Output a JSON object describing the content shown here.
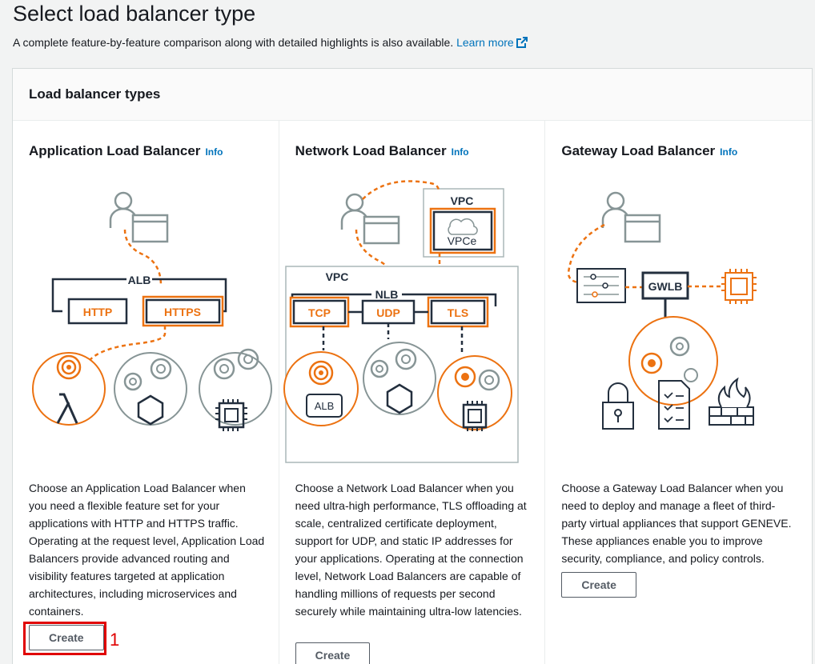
{
  "header": {
    "title": "Select load balancer type",
    "subtitle": "A complete feature-by-feature comparison along with detailed highlights is also available.",
    "learn_more": "Learn more",
    "learn_more_icon": "external-link-icon"
  },
  "panel": {
    "title": "Load balancer types"
  },
  "cards": [
    {
      "title": "Application Load Balancer",
      "info": "Info",
      "diagram": {
        "alb": "ALB",
        "http": "HTTP",
        "https": "HTTPS"
      },
      "description": "Choose an Application Load Balancer when you need a flexible feature set for your applications with HTTP and HTTPS traffic. Operating at the request level, Application Load Balancers provide advanced routing and visibility features targeted at application architectures, including microservices and containers.",
      "button": "Create"
    },
    {
      "title": "Network Load Balancer",
      "info": "Info",
      "diagram": {
        "vpc_top": "VPC",
        "vpce": "VPCe",
        "vpc": "VPC",
        "nlb": "NLB",
        "tcp": "TCP",
        "udp": "UDP",
        "tls": "TLS",
        "alb": "ALB"
      },
      "description": "Choose a Network Load Balancer when you need ultra-high performance, TLS offloading at scale, centralized certificate deployment, support for UDP, and static IP addresses for your applications. Operating at the connection level, Network Load Balancers are capable of handling millions of requests per second securely while maintaining ultra-low latencies.",
      "button": "Create"
    },
    {
      "title": "Gateway Load Balancer",
      "info": "Info",
      "diagram": {
        "gwlb": "GWLB"
      },
      "description": "Choose a Gateway Load Balancer when you need to deploy and manage a fleet of third-party virtual appliances that support GENEVE. These appliances enable you to improve security, compliance, and policy controls.",
      "button": "Create"
    }
  ],
  "annotation": {
    "number": "1",
    "color": "#e00000"
  },
  "colors": {
    "accent": "#ec7211",
    "link": "#0073bb",
    "dark": "#232f3e",
    "gray": "#879596"
  }
}
